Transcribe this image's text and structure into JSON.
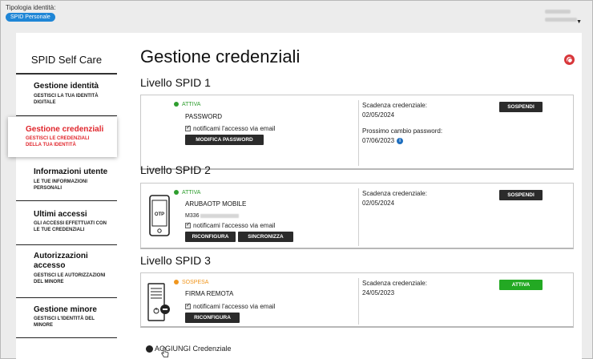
{
  "topbar": {
    "identity_label": "Tipologia identità:",
    "identity_badge": "SPID Personale"
  },
  "sidebar": {
    "title": "SPID Self Care",
    "items": [
      {
        "label": "Gestione identità",
        "sub": "GESTISCI LA TUA IDENTITÀ DIGITALE"
      },
      {
        "label": "Gestione credenziali",
        "sub": "GESTISCI LE CREDENZIALI DELLA TUA IDENTITÀ",
        "active": true
      },
      {
        "label": "Informazioni utente",
        "sub": "LE TUE INFORMAZIONI PERSONALI"
      },
      {
        "label": "Ultimi accessi",
        "sub": "GLI ACCESSI EFFETTUATI CON LE TUE CREDENZIALI"
      },
      {
        "label": "Autorizzazioni accesso",
        "sub": "GESTISCI LE AUTORIZZAZIONI DEL MINORE"
      },
      {
        "label": "Gestione minore",
        "sub": "GESTISCI L'IDENTITÀ DEL MINORE"
      }
    ]
  },
  "main": {
    "title": "Gestione credenziali",
    "add_label": "AGGIUNGI Credenziale"
  },
  "levels": [
    {
      "title": "Livello SPID 1",
      "status": "ATTIVA",
      "status_color": "#2e9e2e",
      "credential": "PASSWORD",
      "notify": "notificami l'accesso via email",
      "buttons": [
        "MODIFICA PASSWORD"
      ],
      "expiry_label": "Scadenza credenziale:",
      "expiry": "02/05/2024",
      "next_change_label": "Prossimo cambio password:",
      "next_change": "07/06/2023",
      "action": "SOSPENDI"
    },
    {
      "title": "Livello SPID 2",
      "status": "ATTIVA",
      "status_color": "#2e9e2e",
      "credential": "ARUBAOTP MOBILE",
      "device": "M336",
      "notify": "notificami l'accesso via email",
      "buttons": [
        "RICONFIGURA",
        "SINCRONIZZA"
      ],
      "expiry_label": "Scadenza credenziale:",
      "expiry": "02/05/2024",
      "action": "SOSPENDI",
      "icon_text": "OTP"
    },
    {
      "title": "Livello SPID 3",
      "status": "SOSPESA",
      "status_color": "#f0961e",
      "credential": "FIRMA REMOTA",
      "notify": "notificami l'accesso via email",
      "buttons": [
        "RICONFIGURA"
      ],
      "expiry_label": "Scadenza credenziale:",
      "expiry": "24/05/2023",
      "action": "ATTIVA"
    }
  ],
  "colors": {
    "accent_red": "#e0262c",
    "badge_blue": "#1f86d6",
    "green": "#23a923",
    "dark_button": "#2b2b2b"
  }
}
